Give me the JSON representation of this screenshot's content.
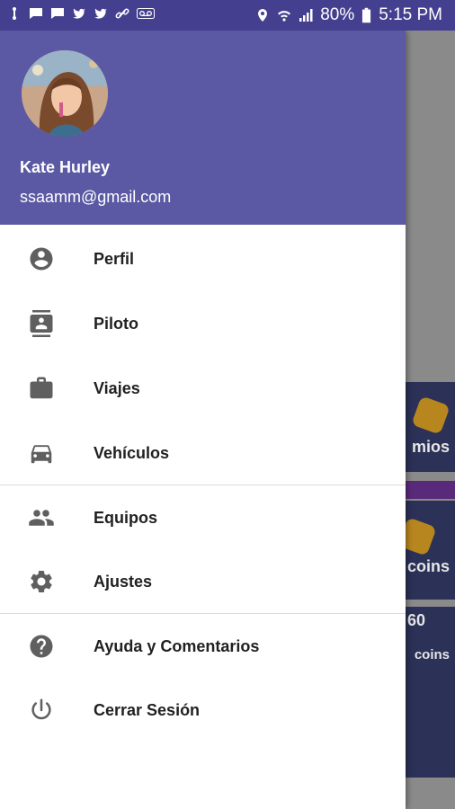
{
  "status_bar": {
    "battery_percent": "80%",
    "time": "5:15 PM",
    "left_icons": [
      "usb-icon",
      "chat-icon",
      "chat-icon",
      "twitter-icon",
      "twitter-icon",
      "link-icon",
      "voicemail-icon"
    ],
    "right_icons": [
      "location-icon",
      "wifi-icon",
      "signal-icon",
      "battery-icon"
    ]
  },
  "drawer": {
    "user": {
      "name": "Kate Hurley",
      "email": "ssaamm@gmail.com"
    },
    "items": [
      {
        "label": "Perfil",
        "icon": "account-circle-icon"
      },
      {
        "label": "Piloto",
        "icon": "contact-card-icon"
      },
      {
        "label": "Viajes",
        "icon": "briefcase-icon"
      },
      {
        "label": "Vehículos",
        "icon": "car-icon"
      },
      {
        "label": "Equipos",
        "icon": "people-icon"
      },
      {
        "label": "Ajustes",
        "icon": "gear-icon"
      },
      {
        "label": "Ayuda y Comentarios",
        "icon": "help-icon"
      },
      {
        "label": "Cerrar Sesión",
        "icon": "power-icon"
      }
    ]
  },
  "background_app": {
    "partial_labels": [
      "mios",
      "coins",
      "60",
      "coins"
    ]
  },
  "colors": {
    "header": "#5b59a3",
    "status_bar": "#453f8f",
    "icon": "#5f5f5f",
    "text": "#212121"
  }
}
